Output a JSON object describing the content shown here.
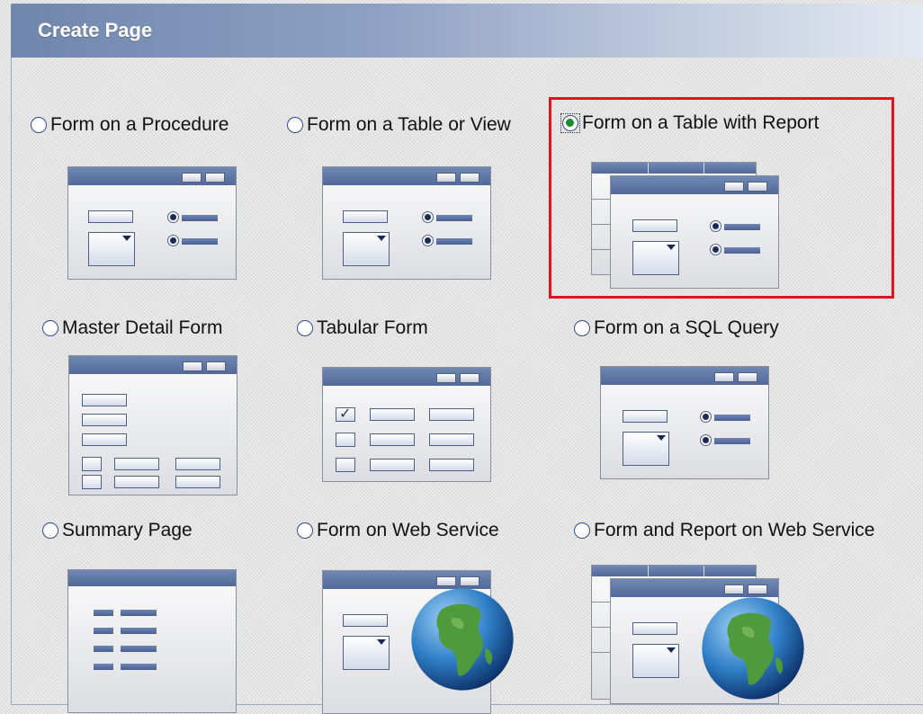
{
  "header": {
    "title": "Create Page"
  },
  "options": {
    "form_on_procedure": "Form on a Procedure",
    "form_on_table_or_view": "Form on a Table or View",
    "form_on_table_with_report": "Form on a Table with Report",
    "master_detail_form": "Master Detail Form",
    "tabular_form": "Tabular Form",
    "form_on_sql_query": "Form on a SQL Query",
    "summary_page": "Summary Page",
    "form_on_web_service": "Form on Web Service",
    "form_and_report_on_web_service": "Form and Report on Web Service"
  },
  "selected_option": "Form on a Table with Report",
  "colors": {
    "header_start": "#6f86ad",
    "selection_highlight": "#e0141c",
    "radio_checked": "#1d8a2c",
    "thumbnail_titlebar": "#52689a"
  },
  "icons": [
    "form-window-icon",
    "report-window-icon",
    "globe-icon",
    "checkmark-icon"
  ]
}
